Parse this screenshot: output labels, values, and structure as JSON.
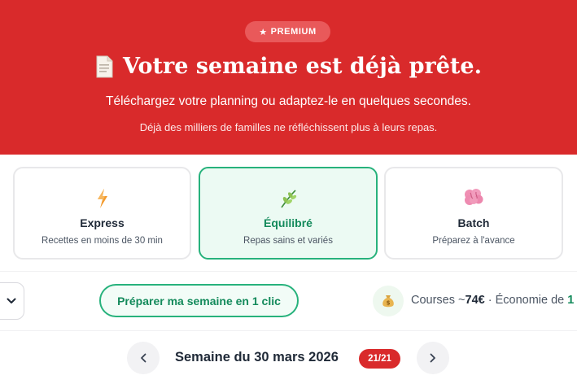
{
  "hero": {
    "badge_label": "PREMIUM",
    "badge_icon": "star-icon",
    "title_icon": "document-icon",
    "title": "Votre semaine est déjà prête.",
    "subtitle": "Téléchargez votre planning ou adaptez-le en quelques secondes.",
    "note": "Déjà des milliers de familles ne réfléchissent plus à leurs repas.",
    "bg_color": "#d92a2b"
  },
  "modes": [
    {
      "name": "Express",
      "description": "Recettes en moins de 30 min",
      "icon": "lightning-icon",
      "selected": false
    },
    {
      "name": "Équilibré",
      "description": "Repas sains et variés",
      "icon": "herb-icon",
      "selected": true
    },
    {
      "name": "Batch",
      "description": "Préparez à l'avance",
      "icon": "brain-icon",
      "selected": false
    }
  ],
  "actions": {
    "dropdown_icon": "chevron-down-icon",
    "prepare_label": "Préparer ma semaine en 1 clic",
    "courses_prefix": "Courses ~",
    "courses_amount": "74€",
    "courses_separator": " · Économie de ",
    "courses_savings": "1",
    "money_icon": "money-bag-icon",
    "accent_color": "#27b27c"
  },
  "week": {
    "label": "Semaine du 30 mars 2026",
    "count": "21/21",
    "prev_icon": "chevron-left-icon",
    "next_icon": "chevron-right-icon"
  }
}
